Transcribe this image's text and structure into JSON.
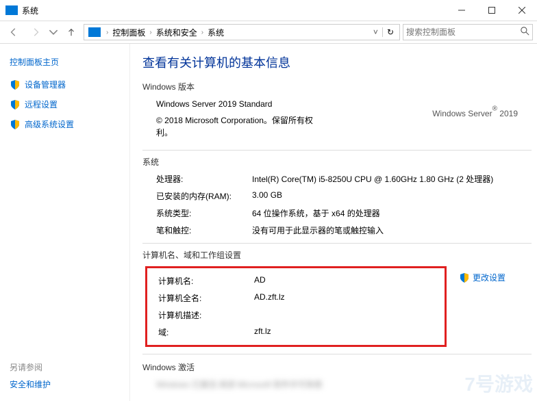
{
  "titlebar": {
    "title": "系统"
  },
  "breadcrumb": {
    "items": [
      "控制面板",
      "系统和安全",
      "系统"
    ]
  },
  "search": {
    "placeholder": "搜索控制面板"
  },
  "sidebar": {
    "home": "控制面板主页",
    "items": [
      {
        "label": "设备管理器"
      },
      {
        "label": "远程设置"
      },
      {
        "label": "高级系统设置"
      }
    ],
    "related_head": "另请参阅",
    "related_items": [
      {
        "label": "安全和维护"
      }
    ]
  },
  "content": {
    "heading": "查看有关计算机的基本信息",
    "edition": {
      "section": "Windows 版本",
      "name": "Windows Server 2019 Standard",
      "copyright": "© 2018 Microsoft Corporation。保留所有权利。",
      "brand_a": "Windows Server",
      "brand_b": " 2019"
    },
    "system": {
      "section": "系统",
      "rows": [
        {
          "k": "处理器:",
          "v": "Intel(R) Core(TM) i5-8250U CPU @ 1.60GHz   1.80 GHz  (2 处理器)"
        },
        {
          "k": "已安装的内存(RAM):",
          "v": "3.00 GB"
        },
        {
          "k": "系统类型:",
          "v": "64 位操作系统，基于 x64 的处理器"
        },
        {
          "k": "笔和触控:",
          "v": "没有可用于此显示器的笔或触控输入"
        }
      ]
    },
    "computer": {
      "section": "计算机名、域和工作组设置",
      "rows": [
        {
          "k": "计算机名:",
          "v": "AD"
        },
        {
          "k": "计算机全名:",
          "v": "AD.zft.lz"
        },
        {
          "k": "计算机描述:",
          "v": ""
        },
        {
          "k": "域:",
          "v": "zft.lz"
        }
      ],
      "change": "更改设置"
    },
    "activation": {
      "section": "Windows 激活"
    }
  }
}
